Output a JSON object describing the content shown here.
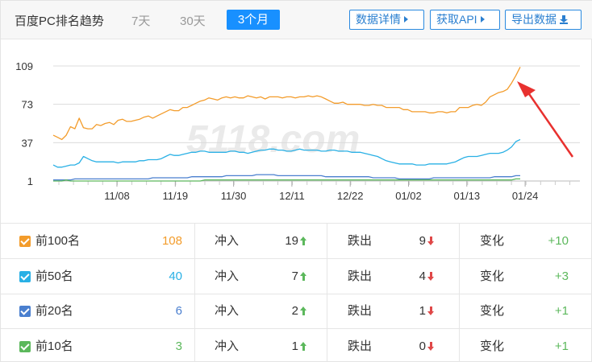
{
  "header": {
    "title": "百度PC排名趋势",
    "ranges": [
      "7天",
      "30天",
      "3个月"
    ],
    "active_range": "3个月",
    "buttons": {
      "data_detail": "数据详情",
      "get_api": "获取API",
      "export": "导出数据"
    }
  },
  "watermark": "5118.com",
  "colors": {
    "accent": "#1890ff",
    "top100": "#f39c2b",
    "top50": "#29b0e5",
    "top20": "#4a7fcf",
    "top10": "#5cb85c",
    "up": "#5cb85c",
    "down": "#e04848",
    "annotation_arrow": "#e8312f"
  },
  "chart_data": {
    "type": "line",
    "x_ticks": [
      "11/08",
      "11/19",
      "11/30",
      "12/11",
      "12/22",
      "01/02",
      "01/13",
      "01/24"
    ],
    "y_ticks": [
      "109",
      "73",
      "37",
      "1"
    ],
    "ylim": [
      1,
      109
    ],
    "grid": true,
    "series": [
      {
        "name": "前100名",
        "color": "#f39c2b",
        "values": [
          44,
          42,
          40,
          44,
          52,
          50,
          60,
          51,
          50,
          50,
          54,
          53,
          55,
          56,
          54,
          58,
          59,
          57,
          57,
          58,
          59,
          61,
          62,
          60,
          62,
          64,
          66,
          68,
          67,
          67,
          70,
          70,
          72,
          74,
          76,
          77,
          79,
          78,
          77,
          79,
          80,
          79,
          80,
          79,
          79,
          81,
          80,
          79,
          80,
          78,
          80,
          80,
          80,
          79,
          80,
          80,
          79,
          80,
          80,
          81,
          80,
          81,
          80,
          78,
          76,
          74,
          74,
          75,
          73,
          73,
          73,
          73,
          72,
          72,
          73,
          72,
          72,
          70,
          70,
          70,
          70,
          68,
          68,
          66,
          66,
          66,
          66,
          65,
          65,
          66,
          66,
          65,
          66,
          66,
          70,
          70,
          70,
          72,
          73,
          72,
          75,
          80,
          82,
          84,
          85,
          87,
          93,
          100,
          108
        ]
      },
      {
        "name": "前50名",
        "color": "#29b0e5",
        "values": [
          16,
          14,
          14,
          15,
          16,
          16,
          18,
          24,
          22,
          20,
          19,
          19,
          19,
          19,
          19,
          18,
          19,
          19,
          19,
          19,
          20,
          20,
          21,
          21,
          21,
          22,
          24,
          26,
          25,
          25,
          26,
          27,
          28,
          28,
          29,
          29,
          28,
          28,
          28,
          28,
          28,
          29,
          29,
          28,
          28,
          27,
          28,
          29,
          30,
          30,
          31,
          31,
          30,
          30,
          29,
          29,
          30,
          31,
          30,
          30,
          30,
          30,
          29,
          29,
          30,
          30,
          29,
          29,
          29,
          28,
          28,
          28,
          27,
          26,
          25,
          24,
          22,
          20,
          19,
          18,
          17,
          17,
          17,
          17,
          16,
          16,
          16,
          17,
          17,
          17,
          17,
          17,
          18,
          19,
          21,
          23,
          24,
          24,
          24,
          25,
          26,
          27,
          27,
          27,
          28,
          30,
          33,
          38,
          40
        ]
      },
      {
        "name": "前20名",
        "color": "#4a7fcf",
        "values": [
          2,
          2,
          2,
          2,
          2,
          3,
          3,
          3,
          3,
          3,
          3,
          3,
          3,
          3,
          3,
          3,
          3,
          3,
          3,
          3,
          3,
          3,
          3,
          4,
          4,
          4,
          4,
          4,
          4,
          4,
          4,
          4,
          5,
          5,
          5,
          5,
          5,
          5,
          5,
          5,
          6,
          6,
          6,
          6,
          6,
          6,
          6,
          7,
          7,
          7,
          7,
          7,
          6,
          6,
          6,
          6,
          6,
          6,
          6,
          6,
          6,
          6,
          6,
          5,
          5,
          5,
          5,
          5,
          5,
          5,
          5,
          5,
          5,
          5,
          4,
          4,
          4,
          4,
          4,
          4,
          3,
          3,
          3,
          3,
          3,
          3,
          3,
          3,
          4,
          4,
          4,
          4,
          4,
          4,
          4,
          4,
          4,
          4,
          4,
          4,
          4,
          4,
          5,
          5,
          5,
          5,
          5,
          6,
          6
        ]
      },
      {
        "name": "前10名",
        "color": "#5cb85c",
        "values": [
          1,
          1,
          1,
          2,
          1,
          1,
          1,
          1,
          1,
          1,
          1,
          1,
          1,
          1,
          1,
          1,
          1,
          1,
          1,
          1,
          1,
          1,
          1,
          1,
          1,
          1,
          1,
          1,
          1,
          1,
          1,
          1,
          1,
          1,
          1,
          2,
          2,
          2,
          2,
          2,
          2,
          2,
          2,
          2,
          2,
          2,
          2,
          2,
          2,
          2,
          2,
          2,
          2,
          2,
          2,
          2,
          2,
          2,
          2,
          2,
          2,
          2,
          2,
          2,
          2,
          2,
          2,
          2,
          2,
          2,
          2,
          2,
          2,
          2,
          2,
          2,
          2,
          2,
          2,
          2,
          2,
          2,
          2,
          2,
          2,
          2,
          2,
          2,
          2,
          2,
          2,
          2,
          2,
          2,
          2,
          2,
          2,
          2,
          2,
          2,
          2,
          2,
          2,
          2,
          2,
          2,
          2,
          3,
          3
        ]
      }
    ]
  },
  "table": {
    "rows": [
      {
        "label": "前100名",
        "count": "108",
        "color": "#f39c2b",
        "rise_label": "冲入",
        "rise": "19",
        "fall_label": "跌出",
        "fall": "9",
        "change_label": "变化",
        "change": "+10"
      },
      {
        "label": "前50名",
        "count": "40",
        "color": "#29b0e5",
        "rise_label": "冲入",
        "rise": "7",
        "fall_label": "跌出",
        "fall": "4",
        "change_label": "变化",
        "change": "+3"
      },
      {
        "label": "前20名",
        "count": "6",
        "color": "#4a7fcf",
        "rise_label": "冲入",
        "rise": "2",
        "fall_label": "跌出",
        "fall": "1",
        "change_label": "变化",
        "change": "+1"
      },
      {
        "label": "前10名",
        "count": "3",
        "color": "#5cb85c",
        "rise_label": "冲入",
        "rise": "1",
        "fall_label": "跌出",
        "fall": "0",
        "change_label": "变化",
        "change": "+1"
      }
    ]
  }
}
